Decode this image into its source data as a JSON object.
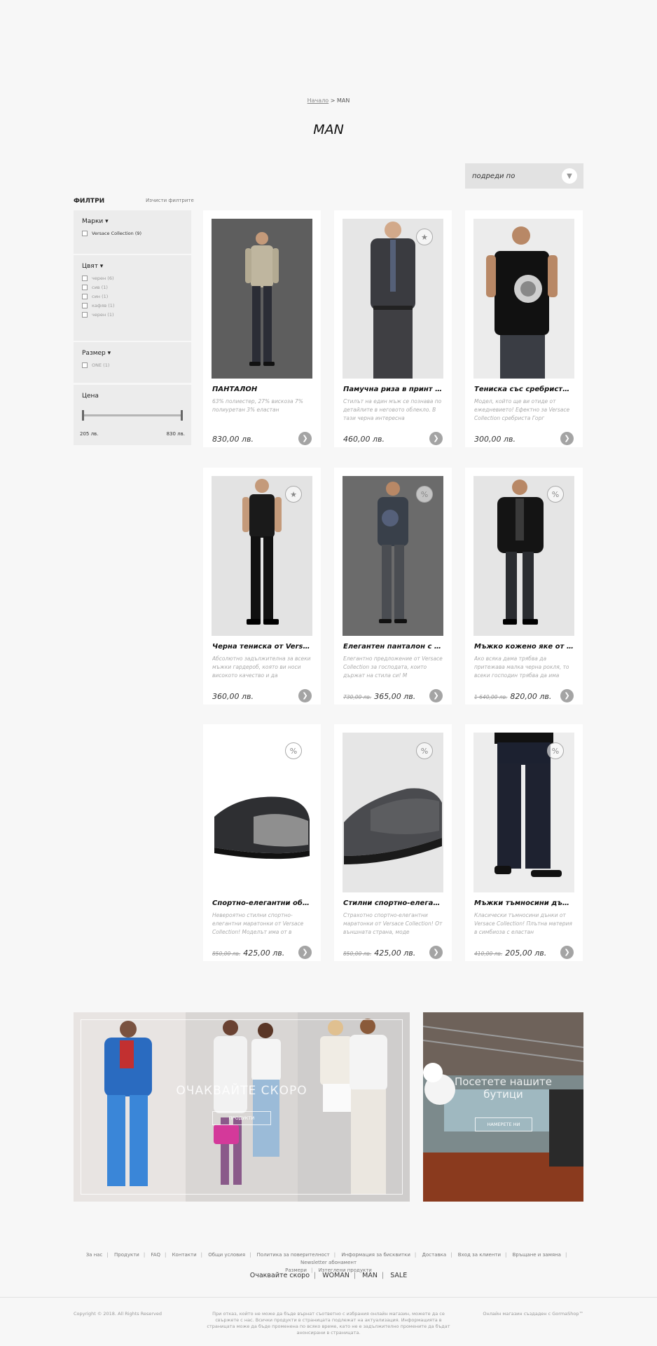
{
  "breadcrumb": {
    "home": "Начало",
    "sep": ">",
    "current": "MAN"
  },
  "page_title": "MAN",
  "sort": {
    "label": "подреди по"
  },
  "filters": {
    "title": "ФИЛТРИ",
    "clear": "Изчисти филтрите",
    "brands": {
      "label": "Марки ▾",
      "options": [
        "Versace Collection (9)"
      ]
    },
    "color": {
      "label": "Цвят ▾",
      "options": [
        "черен (6)",
        "сив (1)",
        "син (1)",
        "кафяв (1)",
        "черен (1)"
      ]
    },
    "size": {
      "label": "Размер ▾",
      "options": [
        "ONE (1)"
      ]
    },
    "price": {
      "label": "Цена",
      "min": "205 лв.",
      "max": "830 лв."
    }
  },
  "products": [
    {
      "name": "ПАНТАЛОН",
      "desc": "63% полиестер, 27% вискоза 7% полиуретан 3% еластан",
      "price": "830,00 лв.",
      "old_price": "",
      "badge": ""
    },
    {
      "name": "Памучна риза в принт мъж...",
      "desc": "Стилът на един мъж се познава по детайлите в неговото облекло. В тази черна интересна",
      "price": "460,00 лв.",
      "old_price": "",
      "badge": "★"
    },
    {
      "name": "Тениска със сребриста Гор...",
      "desc": "Модел, който ще ви отиде от ежедневието! Ефектно за Versace Collection сребриста Горг",
      "price": "300,00 лв.",
      "old_price": "",
      "badge": ""
    },
    {
      "name": "Черна тениска от Versace...",
      "desc": "Абсолютно задължителна за всеки мъжки гардероб, която ви носи високото качество и да",
      "price": "360,00 лв.",
      "old_price": "",
      "badge": "★"
    },
    {
      "name": "Елегантен панталон с ръ...",
      "desc": "Елегантно предложение от Versace Collection за господата, които държат на стила си! М",
      "price": "365,00 лв.",
      "old_price": "730,00 лв.",
      "badge": "%"
    },
    {
      "name": "Мъжко кожено яке от Vers...",
      "desc": "Ако всяка дама трябва да притежава малка черна рокля, то всеки господин трябва да има",
      "price": "820,00 лв.",
      "old_price": "1 640,00 лв.",
      "badge": "%"
    },
    {
      "name": "Спортно-елегантни обув...",
      "desc": "Невероятно стилни спортно-елегантни маратонки от Versace Collection! Моделът има от в",
      "price": "425,00 лв.",
      "old_price": "850,00 лв.",
      "badge": "%"
    },
    {
      "name": "Стилни спортно-елегант...",
      "desc": "Страхотно спортно-елегантни маратонки от Versace Collection! От външната страна, моде",
      "price": "425,00 лв.",
      "old_price": "850,00 лв.",
      "badge": "%"
    },
    {
      "name": "Мъжки тъмносини дънки ...",
      "desc": "Класически тъмносини дънки от Versace Collection! Плътна материя в симбиоза с еластан",
      "price": "205,00 лв.",
      "old_price": "410,00 лв.",
      "badge": "%"
    }
  ],
  "banners": {
    "left": {
      "title": "ОЧАКВАЙТЕ СКОРО",
      "button": "ПРОДУКТИ"
    },
    "right": {
      "title": "Посетете нашите бутици",
      "button": "НАМЕРЕТЕ НИ"
    }
  },
  "footer": {
    "links": [
      "За нас",
      "Продукти",
      "FAQ",
      "Контакти",
      "Общи условия",
      "Политика за поверителност",
      "Информация за бисквитки",
      "Доставка",
      "Вход за клиенти",
      "Връщане и замяна",
      "Newsletter абонамент",
      "Размери",
      "Изтеглени продукти"
    ],
    "nav": [
      "Очаквайте скоро",
      "WOMAN",
      "MAN",
      "SALE"
    ],
    "copyright": "Copyright © 2018. All Rights Reserved",
    "disclaimer": "При отказ, който не може да бъде върнат съответно с избрания онлайн магазин, можете да се свържете с нас. Всички продукти в страницата подлежат на актуализация. Информацията в страницата може да бъде променена по всяко време, като не е задължително промените да бъдат анонсирани в страницата.",
    "maker": "Онлайн магазин създаден с GormaShop™"
  },
  "colors": {
    "page_bg": "#f7f7f7",
    "panel_bg": "#ececec",
    "button_grey": "#a4a4a4"
  }
}
